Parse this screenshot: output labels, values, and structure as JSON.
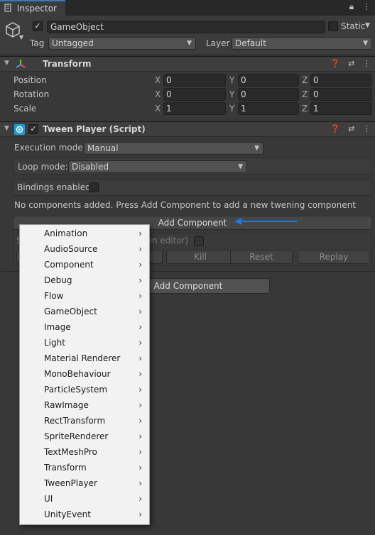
{
  "tab": {
    "label": "Inspector",
    "right_icons": [
      "lock-icon",
      "kebab-menu-icon"
    ]
  },
  "gameobject": {
    "active": "✓",
    "name": "GameObject",
    "static_label": "Static",
    "tag_label": "Tag",
    "tag_value": "Untagged",
    "layer_label": "Layer",
    "layer_value": "Default"
  },
  "transform": {
    "title": "Transform",
    "rows": [
      {
        "label": "Position",
        "x": "0",
        "y": "0",
        "z": "0"
      },
      {
        "label": "Rotation",
        "x": "0",
        "y": "0",
        "z": "0"
      },
      {
        "label": "Scale",
        "x": "1",
        "y": "1",
        "z": "1"
      }
    ],
    "axis": {
      "x": "X",
      "y": "Y",
      "z": "Z"
    }
  },
  "tween": {
    "enabled": "✓",
    "title": "Tween Player (Script)",
    "execution_label": "Execution mode:",
    "execution_value": "Manual",
    "loop_label": "Loop mode:",
    "loop_value": "Disabled",
    "bindings_label": "Bindings enabled",
    "info_text": "No components added. Press Add Component to add a new twening component",
    "add_component_label": "Add Component",
    "partial_text_left": "S",
    "partial_text_right": "wn editor)",
    "kill_label": "Kill",
    "reset_label": "Reset",
    "replay_label": "Replay"
  },
  "inspector_add_component_label": "Add Component",
  "menu": {
    "items": [
      "Animation",
      "AudioSource",
      "Component",
      "Debug",
      "Flow",
      "GameObject",
      "Image",
      "Light",
      "Material Renderer",
      "MonoBehaviour",
      "ParticleSystem",
      "RawImage",
      "RectTransform",
      "SpriteRenderer",
      "TextMeshPro",
      "Transform",
      "TweenPlayer",
      "UI",
      "UnityEvent"
    ],
    "arrow": "›"
  },
  "colors": {
    "accent_blue": "#1e7ae0",
    "panel_bg": "#383838",
    "menu_bg": "#f2f2f2"
  }
}
